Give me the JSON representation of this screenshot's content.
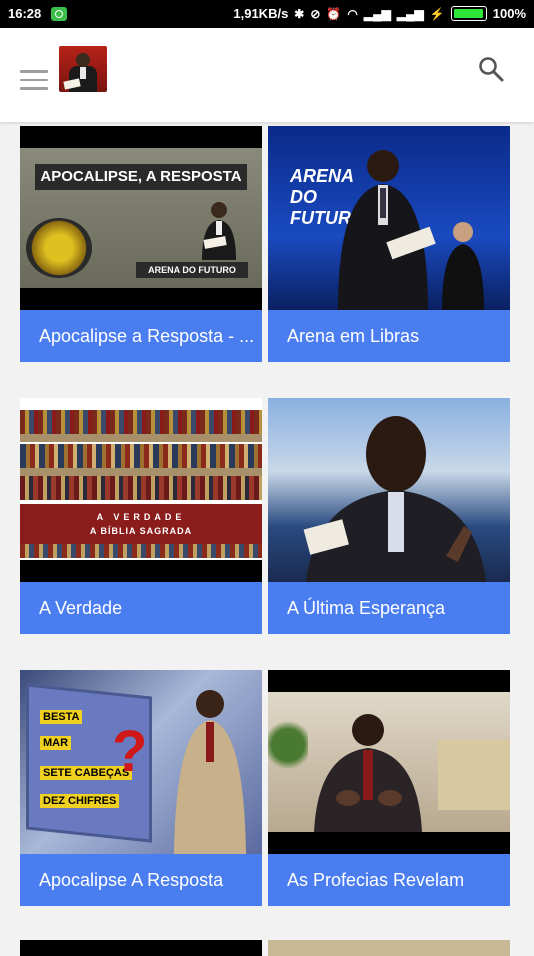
{
  "status_bar": {
    "time": "16:28",
    "speed": "1,91KB/s",
    "battery": "100%"
  },
  "app_bar": {
    "menu_icon": "hamburger-menu-icon",
    "logo": "channel-logo",
    "search_icon": "search-icon"
  },
  "videos": [
    {
      "title": "Apocalipse a Resposta - ...",
      "thumb_title": "APOCALIPSE, A RESPOSTA",
      "thumb_sub": "ARENA DO FUTURO"
    },
    {
      "title": "Arena em Libras",
      "thumb_title": "ARENA DO FUTURO"
    },
    {
      "title": "A Verdade",
      "thumb_line1": "A VERDADE",
      "thumb_line2": "A BÍBLIA SAGRADA"
    },
    {
      "title": "A Última Esperança"
    },
    {
      "title": "Apocalipse A Resposta",
      "thumb_words": [
        "BESTA",
        "MAR",
        "SETE CABEÇAS",
        "DEZ CHIFRES"
      ],
      "thumb_mark": "?"
    },
    {
      "title": "As Profecias Revelam"
    }
  ],
  "colors": {
    "caption_bg": "#4a7ef0",
    "app_bar_bg": "#ffffff",
    "page_bg": "#f2f2f2"
  }
}
